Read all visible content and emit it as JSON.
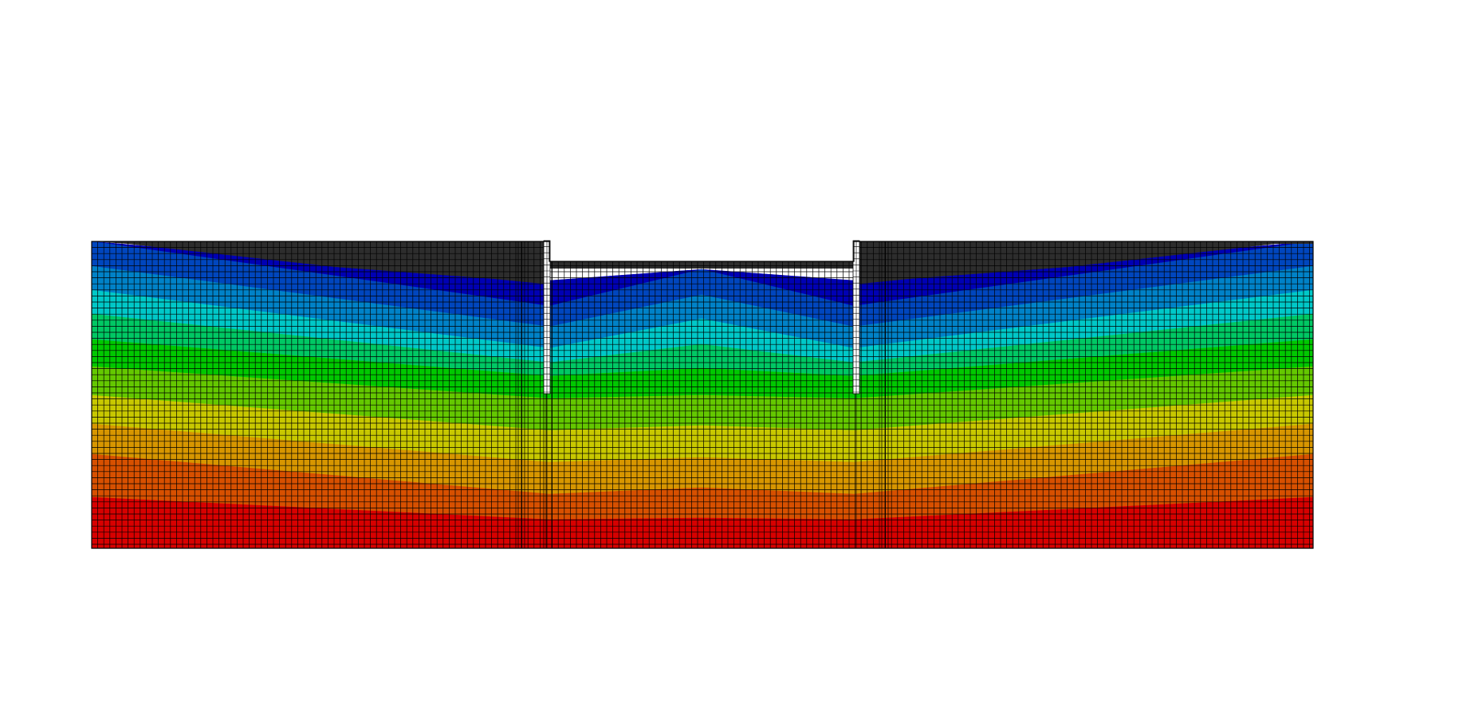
{
  "figure": {
    "kind": "finite-element excavation mesh contour",
    "colormap": [
      "#0000b4",
      "#0046be",
      "#0082c8",
      "#00c8c8",
      "#00c864",
      "#00c800",
      "#64c800",
      "#c8c800",
      "#d79600",
      "#d75000",
      "#d70000"
    ],
    "unsaturated_color": "#2d2d2d",
    "wall_color": "#ffffff",
    "grid_line_color": "#000000",
    "background": "#ffffff"
  }
}
